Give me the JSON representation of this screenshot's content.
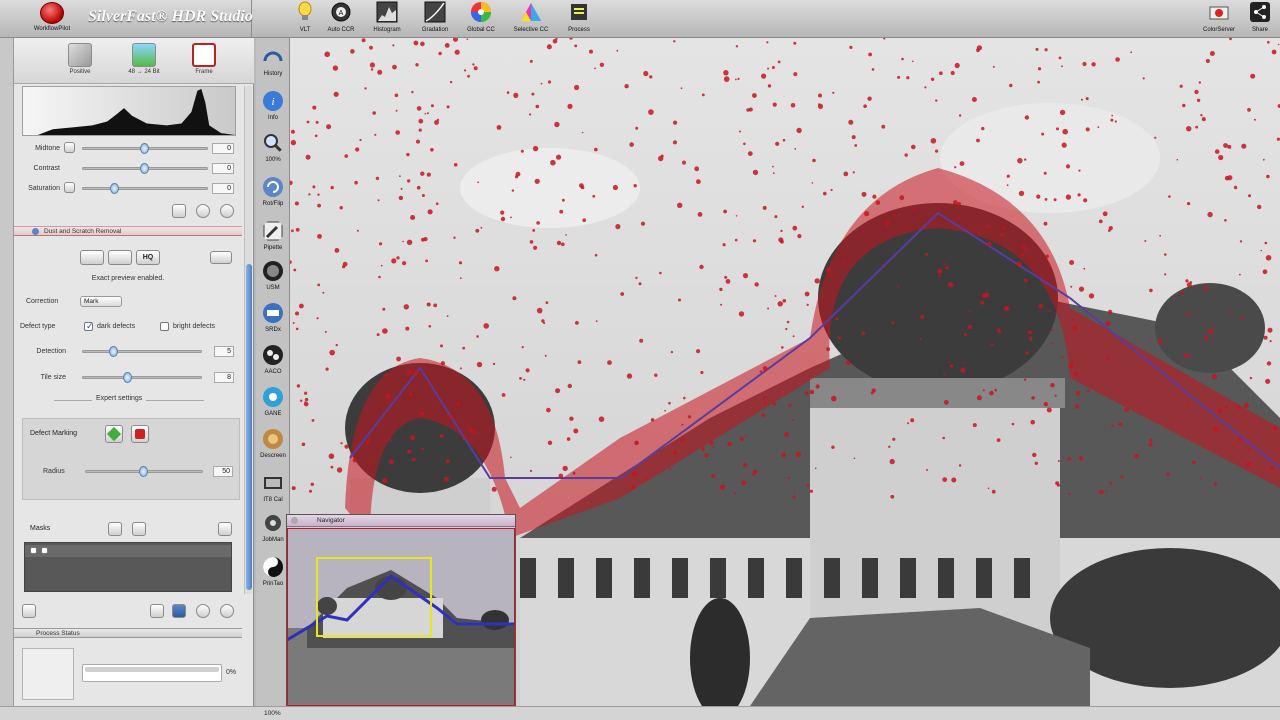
{
  "app": {
    "brand": "SilverFast® HDR Studio",
    "workflow_label": "WorkflowPilot"
  },
  "toolbar": {
    "items": [
      {
        "label": "VLT",
        "icon": "bulb-icon"
      },
      {
        "label": "Auto CCR",
        "icon": "auto-icon"
      },
      {
        "label": "Histogram",
        "icon": "histogram-icon"
      },
      {
        "label": "Gradation",
        "icon": "gradation-icon"
      },
      {
        "label": "Global CC",
        "icon": "color-wheel-icon"
      },
      {
        "label": "Selective CC",
        "icon": "selective-color-icon"
      },
      {
        "label": "Process",
        "icon": "process-icon"
      }
    ],
    "right_items": [
      {
        "label": "ColorServer",
        "icon": "color-server-icon"
      },
      {
        "label": "Share",
        "icon": "share-icon"
      }
    ]
  },
  "modes": [
    {
      "label": "Positive",
      "icon": "positive-icon"
    },
    {
      "label": "48 → 24 Bit",
      "icon": "bit-depth-icon"
    },
    {
      "label": "Frame",
      "icon": "frame-icon"
    }
  ],
  "adjust": {
    "midtone": {
      "label": "Midtone",
      "value": "0",
      "level": 0.5
    },
    "contrast": {
      "label": "Contrast",
      "value": "0",
      "level": 0.5
    },
    "saturation": {
      "label": "Saturation",
      "value": "0",
      "level": 0.26
    }
  },
  "dsr": {
    "title": "Dust and Scratch Removal",
    "quality_buttons": [
      "",
      "",
      "HQ"
    ],
    "preview_msg": "Exact preview enabled.",
    "correction_label": "Correction",
    "correction_value": "Mark",
    "defect_type_label": "Defect type",
    "dark_defects": "dark defects",
    "bright_defects": "bright defects",
    "detection_label": "Detection",
    "detection_value": "5",
    "detection_level": 0.26,
    "tile_size_label": "Tile size",
    "tile_size_value": "8",
    "tile_size_level": 0.38,
    "expert_label": "Expert settings",
    "defect_marking_label": "Defect Marking",
    "radius_label": "Radius",
    "radius_value": "50",
    "radius_level": 0.5,
    "masks_label": "Masks"
  },
  "process_status": {
    "title": "Process Status",
    "percent": "0%",
    "progress": 0.0
  },
  "tools": [
    {
      "label": "History",
      "icon": "history-icon"
    },
    {
      "label": "Info",
      "icon": "info-icon"
    },
    {
      "label": "100%",
      "icon": "zoom-icon"
    },
    {
      "label": "Rot/Flip",
      "icon": "rotate-icon"
    },
    {
      "label": "Pipette",
      "icon": "pipette-icon"
    },
    {
      "label": "USM",
      "icon": "usm-icon"
    },
    {
      "label": "SRDx",
      "icon": "srdx-icon"
    },
    {
      "label": "AACO",
      "icon": "aaco-icon"
    },
    {
      "label": "GANE",
      "icon": "gane-icon"
    },
    {
      "label": "Descreen",
      "icon": "descreen-icon"
    },
    {
      "label": "IT8 Cal",
      "icon": "it8-icon"
    },
    {
      "label": "JobMan",
      "icon": "jobman-icon"
    },
    {
      "label": "PrinTao",
      "icon": "printao-icon"
    }
  ],
  "navigator": {
    "title": "Navigator"
  },
  "status": {
    "zoom": "100%"
  },
  "colors": {
    "mark_red": "#c8141e",
    "select_yellow": "#e6e626",
    "outline_purple": "#5a3ca0",
    "accent_blue": "#4c7fc2"
  }
}
